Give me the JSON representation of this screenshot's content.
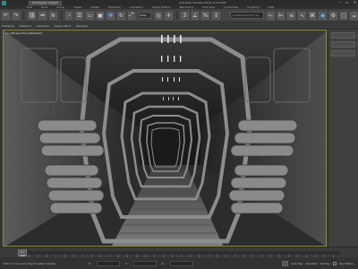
{
  "titlebar": {
    "workspace": "Workspace: Default",
    "title": "Autodesk 3ds Max 2015    lvl 9 Untitl"
  },
  "menubar": {
    "items": [
      "Edit",
      "Tools",
      "Group",
      "Views",
      "Create",
      "Modifiers",
      "Animation",
      "Graph Editors",
      "Rendering",
      "Civil View",
      "Customize",
      "Scripting",
      "Help"
    ]
  },
  "toolbar": {
    "view_combo": "View",
    "selection_placeholder": "Create Selection Se"
  },
  "ribbon": {
    "items": [
      "Modeling",
      "Freeform",
      "Selection",
      "Object Paint",
      "Populate"
    ]
  },
  "viewport": {
    "label": "[+] [Perspective] [Realistic]"
  },
  "timeline": {
    "slider": "0 / 100"
  },
  "statusbar": {
    "status": "Click or click-and-drag to select objects",
    "coords": [
      "X:",
      "Y:",
      "Z:"
    ],
    "autokey": "Auto Key",
    "setkey": "Set Key",
    "selected": "Selected",
    "key_filters": "Key Filters..."
  },
  "colors": {
    "viewport_border": "#8a8a3a",
    "accent": "#6fb7ff"
  }
}
